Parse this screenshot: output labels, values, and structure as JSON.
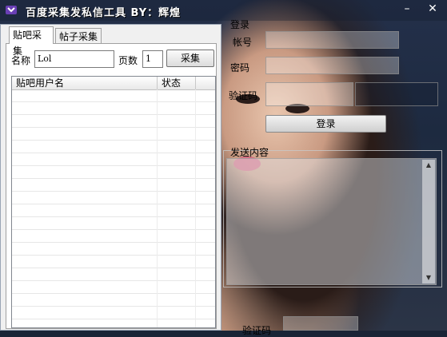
{
  "window": {
    "title": "百度采集发私信工具 BY：辉煌",
    "minimize_glyph": "–",
    "close_glyph": "✕"
  },
  "tabs": [
    "贴吧采集",
    "帖子采集"
  ],
  "collect_form": {
    "name_label": "名称",
    "name_value": "Lol",
    "pages_label": "页数",
    "pages_value": "1",
    "collect_button": "采集"
  },
  "user_list": {
    "columns": [
      "贴吧用户名",
      "状态"
    ],
    "rows": []
  },
  "login": {
    "group_label": "登录",
    "account_label": "帐号",
    "password_label": "密码",
    "captcha_label": "验证码",
    "login_button": "登录"
  },
  "send": {
    "content_label": "发送内容"
  },
  "bottom": {
    "captcha_label": "验证码"
  },
  "icons": {
    "app": "app-logo-icon",
    "scroll_up": "scroll-up-icon",
    "scroll_down": "scroll-down-icon"
  }
}
